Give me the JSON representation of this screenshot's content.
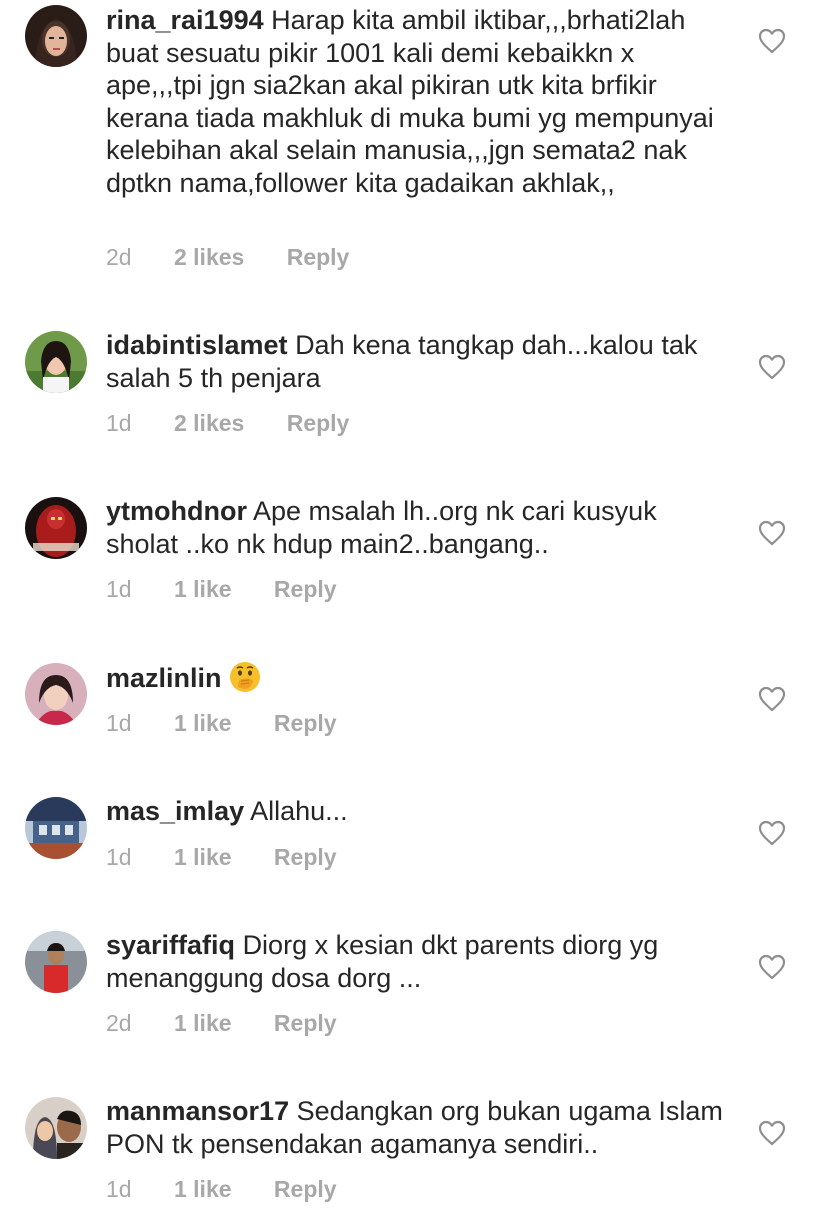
{
  "comments": [
    {
      "username": "rina_rai1994",
      "text": "Harap kita ambil iktibar,,,brhati2lah buat sesuatu pikir 1001 kali demi kebaikkn x ape,,,tpi jgn sia2kan akal pikiran utk kita brfikir kerana tiada makhluk di muka bumi yg mempunyai kelebihan akal selain manusia,,,jgn semata2 nak dptkn nama,follower kita gadaikan akhlak,,",
      "time": "2d",
      "likes": "2 likes",
      "reply": "Reply",
      "avatar_color": "#5a3a2c"
    },
    {
      "username": "idabintislamet",
      "text": "Dah kena tangkap dah...kalou tak salah 5 th penjara",
      "time": "1d",
      "likes": "2 likes",
      "reply": "Reply",
      "avatar_color": "#7a9a54"
    },
    {
      "username": "ytmohdnor",
      "text": "Ape msalah lh..org nk cari kusyuk sholat ..ko nk hdup main2..bangang..",
      "time": "1d",
      "likes": "1 like",
      "reply": "Reply",
      "avatar_color": "#9c1c1c"
    },
    {
      "username": "mazlinlin",
      "text": "",
      "emoji": "face-with-hand-over-mouth",
      "time": "1d",
      "likes": "1 like",
      "reply": "Reply",
      "avatar_color": "#c28a9c"
    },
    {
      "username": "mas_imlay",
      "text": "Allahu...",
      "time": "1d",
      "likes": "1 like",
      "reply": "Reply",
      "avatar_color": "#3c4a6a"
    },
    {
      "username": "syariffafiq",
      "text": "Diorg x kesian dkt parents diorg yg menanggung dosa dorg ...",
      "time": "2d",
      "likes": "1 like",
      "reply": "Reply",
      "avatar_color": "#c23a2c"
    },
    {
      "username": "manmansor17",
      "text": "Sedangkan org bukan ugama Islam PON tk pensendakan agamanya sendiri..",
      "time": "1d",
      "likes": "1 like",
      "reply": "Reply",
      "avatar_color": "#6a5444"
    }
  ],
  "colors": {
    "text": "#262626",
    "meta": "#a8a8a8",
    "heart_stroke": "#8e8e8e"
  },
  "icons": {
    "like": "heart-outline-icon"
  }
}
